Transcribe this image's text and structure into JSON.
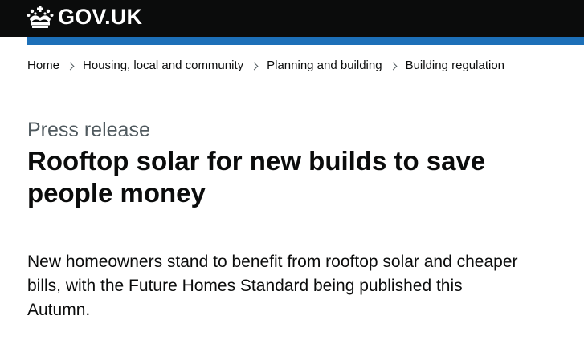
{
  "header": {
    "logo_text": "GOV.UK",
    "logo_icon": "crown-icon",
    "background_color": "#0b0c0c",
    "accent_color": "#1d70b8"
  },
  "breadcrumbs": [
    {
      "label": "Home"
    },
    {
      "label": "Housing, local and community"
    },
    {
      "label": "Planning and building"
    },
    {
      "label": "Building regulation"
    }
  ],
  "main": {
    "caption": "Press release",
    "title": "Rooftop solar for new builds to save people money",
    "lede": "New homeowners stand to benefit from rooftop solar and cheaper bills, with the Future Homes Standard being published this Autumn."
  }
}
